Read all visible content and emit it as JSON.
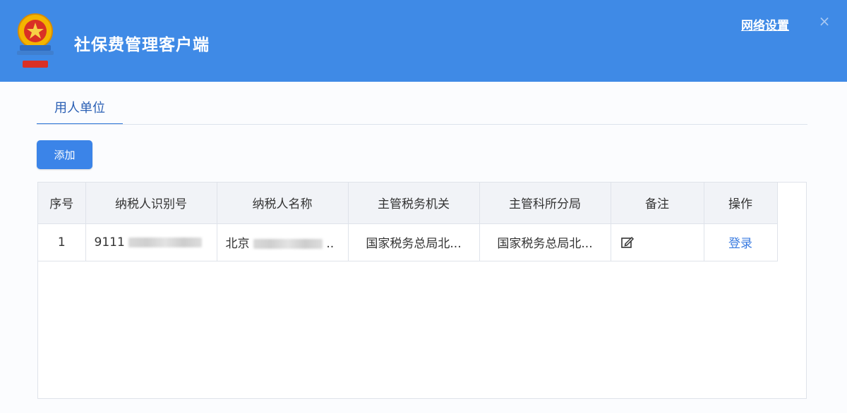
{
  "app": {
    "title": "社保费管理客户端",
    "network_settings": "网络设置",
    "close_icon": "×",
    "brand_color": "#3f8ae6"
  },
  "tabs": [
    {
      "label": "用人单位",
      "active": true
    }
  ],
  "toolbar": {
    "add_label": "添加"
  },
  "table": {
    "columns": [
      "序号",
      "纳税人识别号",
      "纳税人名称",
      "主管税务机关",
      "主管科所分局",
      "备注",
      "操作"
    ],
    "rows": [
      {
        "index": "1",
        "taxpayer_id_visible": "9111",
        "taxpayer_name_visible": "北京",
        "taxpayer_name_ellipsis": "..",
        "tax_authority": "国家税务总局北...",
        "tax_branch": "国家税务总局北...",
        "remark_icon": "edit-icon",
        "action_label": "登录"
      }
    ]
  }
}
